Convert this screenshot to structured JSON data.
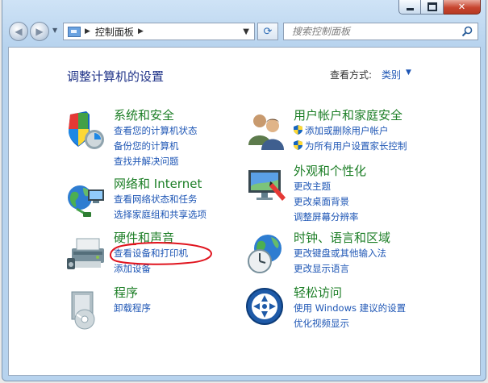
{
  "window": {
    "caption_buttons": {
      "minimize": "minimize",
      "maximize": "maximize",
      "close": "close"
    }
  },
  "nav": {
    "breadcrumb": "控制面板",
    "search_placeholder": "搜索控制面板"
  },
  "header": {
    "title": "调整计算机的设置",
    "view_by_label": "查看方式:",
    "view_by_value": "类别"
  },
  "categories": [
    {
      "title": "系统和安全",
      "icon": "system-security-icon",
      "links": [
        "查看您的计算机状态",
        "备份您的计算机",
        "查找并解决问题"
      ]
    },
    {
      "title": "网络和 Internet",
      "icon": "network-icon",
      "links": [
        "查看网络状态和任务",
        "选择家庭组和共享选项"
      ]
    },
    {
      "title": "硬件和声音",
      "icon": "hardware-sound-icon",
      "links": [
        "查看设备和打印机",
        "添加设备"
      ]
    },
    {
      "title": "程序",
      "icon": "programs-icon",
      "links": [
        "卸载程序"
      ]
    },
    {
      "title": "用户帐户和家庭安全",
      "icon": "user-accounts-icon",
      "links": [
        "添加或删除用户帐户",
        "为所有用户设置家长控制"
      ]
    },
    {
      "title": "外观和个性化",
      "icon": "appearance-icon",
      "links": [
        "更改主题",
        "更改桌面背景",
        "调整屏幕分辨率"
      ]
    },
    {
      "title": "时钟、语言和区域",
      "icon": "clock-region-icon",
      "links": [
        "更改键盘或其他输入法",
        "更改显示语言"
      ]
    },
    {
      "title": "轻松访问",
      "icon": "ease-of-access-icon",
      "links": [
        "使用 Windows 建议的设置",
        "优化视频显示"
      ]
    }
  ],
  "annotation": {
    "color": "#e0141e"
  },
  "colors": {
    "title_green": "#1c7e26",
    "link_blue": "#1e56b5",
    "heading_blue": "#1e3287"
  }
}
